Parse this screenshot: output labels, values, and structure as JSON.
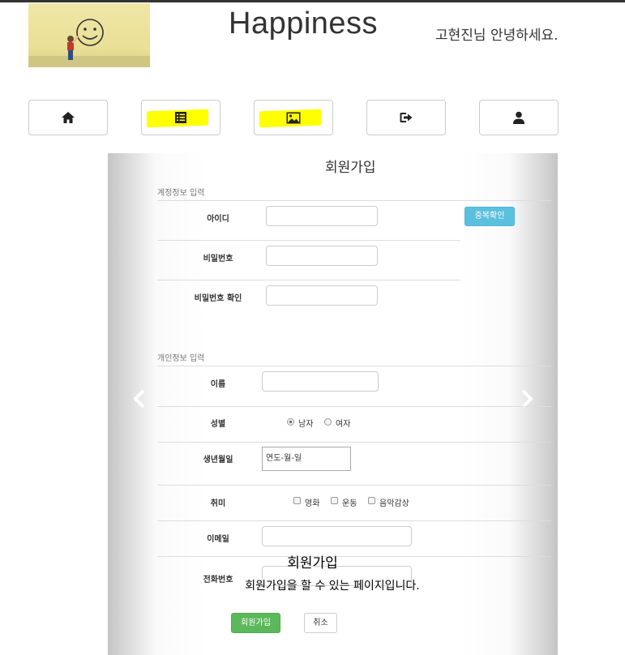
{
  "header": {
    "title": "Happiness",
    "greeting": "고현진님 안녕하세요."
  },
  "nav": {
    "items": [
      {
        "icon": "home-icon"
      },
      {
        "icon": "list-icon",
        "highlight": "#ffff00"
      },
      {
        "icon": "picture-icon",
        "highlight": "#ffff00"
      },
      {
        "icon": "logout-icon"
      },
      {
        "icon": "user-icon"
      }
    ]
  },
  "form": {
    "title": "회원가입",
    "account_section": "계정정보 입력",
    "id_label": "아이디",
    "dup_check_button": "중복확인",
    "password_label": "비밀번호",
    "password_confirm_label": "비밀번호 확인",
    "personal_section": "개인정보 입력",
    "name_label": "이름",
    "gender_label": "성별",
    "gender_male": "남자",
    "gender_female": "여자",
    "birth_label": "생년월일",
    "birth_value": "연도-월-일",
    "hobby_label": "취미",
    "hobby_movie": "영화",
    "hobby_sport": "운동",
    "hobby_music": "음악감상",
    "email_label": "이메일",
    "phone_label": "전화번호",
    "submit_button": "회원가입",
    "cancel_button": "취소"
  },
  "carousel": {
    "caption_title": "회원가입",
    "caption_text": "회원가입을 할 수 있는 페이지입니다."
  },
  "colors": {
    "nav_highlight": "#ffff00",
    "dup_check": "#5bc0de",
    "submit": "#5cb85c"
  }
}
